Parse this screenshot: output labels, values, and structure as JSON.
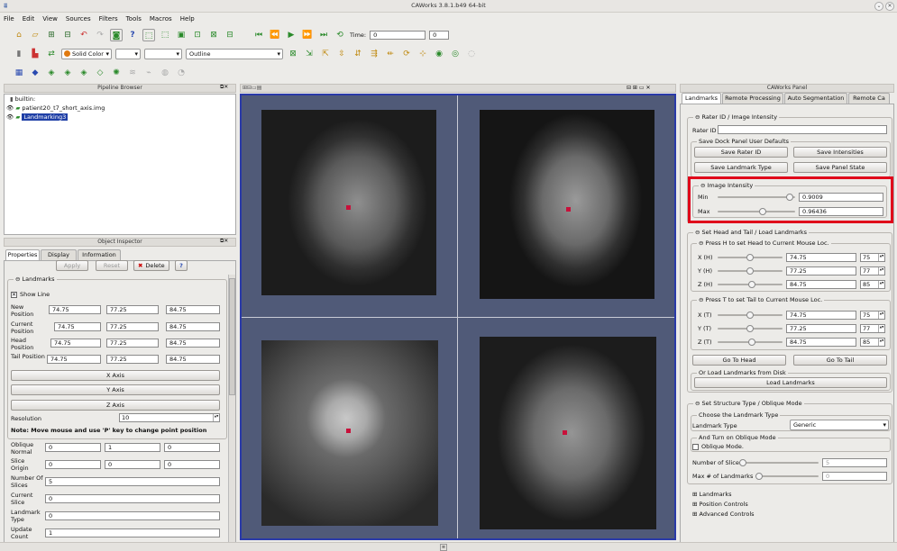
{
  "window": {
    "title": "CAWorks 3.8.1.b49 64-bit"
  },
  "menu": [
    "File",
    "Edit",
    "View",
    "Sources",
    "Filters",
    "Tools",
    "Macros",
    "Help"
  ],
  "toolbar": {
    "time_label": "Time:",
    "time_value": "0",
    "time_index": "0",
    "solid_color": "Solid Color",
    "outline": "Outline"
  },
  "pipeline": {
    "title": "Pipeline Browser",
    "items": [
      "builtin:",
      "patient20_t7_short_axis.img",
      "Landmarking3"
    ]
  },
  "inspector": {
    "title": "Object Inspector",
    "tabs": [
      "Properties",
      "Display",
      "Information"
    ],
    "apply": "Apply",
    "reset": "Reset",
    "delete": "Delete",
    "help": "?",
    "landmarks_group": "Landmarks",
    "show_line": "Show Line",
    "rows": [
      {
        "label": "New Position",
        "v": [
          "74.75",
          "77.25",
          "84.75"
        ]
      },
      {
        "label": "Current Position",
        "v": [
          "74.75",
          "77.25",
          "84.75"
        ]
      },
      {
        "label": "Head Position",
        "v": [
          "74.75",
          "77.25",
          "84.75"
        ]
      },
      {
        "label": "Tail Position",
        "v": [
          "74.75",
          "77.25",
          "84.75"
        ]
      }
    ],
    "axes": [
      "X Axis",
      "Y Axis",
      "Z Axis"
    ],
    "resolution_label": "Resolution",
    "resolution": "10",
    "note": "Note: Move mouse and use 'P' key to change point position",
    "oblique_normal": {
      "label": "Oblique Normal",
      "v": [
        "0",
        "1",
        "0"
      ]
    },
    "slice_origin": {
      "label": "Slice Origin",
      "v": [
        "0",
        "0",
        "0"
      ]
    },
    "number_of_slices": {
      "label": "Number Of Slices",
      "v": "5"
    },
    "current_slice": {
      "label": "Current Slice",
      "v": "0"
    },
    "landmark_type": {
      "label": "Landmark Type",
      "v": "0"
    },
    "update_count": {
      "label": "Update Count",
      "v": "1"
    }
  },
  "right": {
    "title": "CAWorks Panel",
    "tabs": [
      "Landmarks",
      "Remote Processing",
      "Auto Segmentation",
      "Remote Ca"
    ],
    "rater_group": "Rater ID / Image Intensity",
    "rater_label": "Rater ID",
    "rater_value": "",
    "save_group": "Save Dock Panel User Defaults",
    "save_rater": "Save Rater ID",
    "save_intensities": "Save Intensities",
    "save_landmark_type": "Save Landmark Type",
    "save_panel_state": "Save Panel State",
    "intensity_group": "Image Intensity",
    "min_label": "Min",
    "min": "0.9009",
    "max_label": "Max",
    "max": "0.96436",
    "headtail_group": "Set Head and Tail / Load Landmarks",
    "head_group": "Press H to set Head to Current Mouse Loc.",
    "head": [
      {
        "label": "X (H)",
        "v": "74.75",
        "s": "75"
      },
      {
        "label": "Y (H)",
        "v": "77.25",
        "s": "77"
      },
      {
        "label": "Z (H)",
        "v": "84.75",
        "s": "85"
      }
    ],
    "tail_group": "Press T to set Tail to Current Mouse Loc.",
    "tail": [
      {
        "label": "X (T)",
        "v": "74.75",
        "s": "75"
      },
      {
        "label": "Y (T)",
        "v": "77.25",
        "s": "77"
      },
      {
        "label": "Z (T)",
        "v": "84.75",
        "s": "85"
      }
    ],
    "go_head": "Go To Head",
    "go_tail": "Go To Tail",
    "load_group": "Or Load Landmarks from Disk",
    "load": "Load Landmarks",
    "structure_group": "Set Structure Type / Oblique Mode",
    "choose_group": "Choose the Landmark Type",
    "landmark_type_label": "Landmark Type",
    "landmark_type": "Generic",
    "oblique_group": "And Turn on Oblique Mode",
    "oblique_label": "Oblique Mode.",
    "num_slices_label": "Number of Slices",
    "num_slices": "5",
    "max_landmarks_label": "Max # of Landmarks",
    "max_landmarks": "0",
    "collapsed": [
      "Landmarks",
      "Position Controls",
      "Advanced Controls"
    ]
  },
  "colors": {
    "highlight": "#e0001a",
    "selection": "#1f3fa6",
    "viewport_bg": "#505a78",
    "marker": "#c8103a"
  }
}
